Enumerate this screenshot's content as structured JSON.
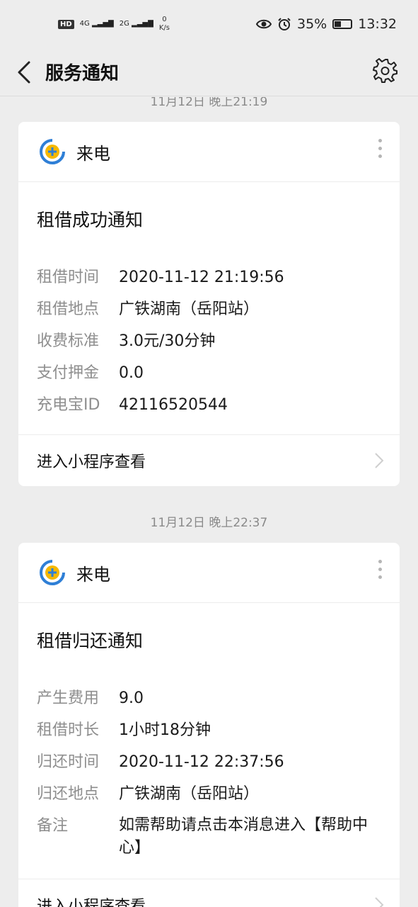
{
  "status_bar": {
    "hd": "HD",
    "net1": "4G",
    "net2": "2G",
    "speed_value": "0",
    "speed_unit": "K/s",
    "battery": "35%",
    "battery_level": 0.35,
    "time": "13:32"
  },
  "header": {
    "title": "服务通知"
  },
  "feed": {
    "partial_timestamp": "11月12日 晚上21:19",
    "cards": [
      {
        "app_name": "来电",
        "title": "租借成功通知",
        "fields": [
          {
            "k": "租借时间",
            "v": "2020-11-12 21:19:56"
          },
          {
            "k": "租借地点",
            "v": "广铁湖南（岳阳站）"
          },
          {
            "k": "收费标准",
            "v": "3.0元/30分钟"
          },
          {
            "k": "支付押金",
            "v": "0.0"
          },
          {
            "k": "充电宝ID",
            "v": "42116520544"
          }
        ],
        "footer": "进入小程序查看"
      },
      {
        "timestamp": "11月12日 晚上22:37",
        "app_name": "来电",
        "title": "租借归还通知",
        "fields": [
          {
            "k": "产生费用",
            "v": "9.0"
          },
          {
            "k": "租借时长",
            "v": "1小时18分钟"
          },
          {
            "k": "归还时间",
            "v": "2020-11-12 22:37:56"
          },
          {
            "k": "归还地点",
            "v": "广铁湖南（岳阳站）"
          },
          {
            "k": "备注",
            "v": "如需帮助请点击本消息进入【帮助中心】"
          }
        ],
        "footer": "进入小程序查看"
      }
    ]
  },
  "colors": {
    "background": "#ededed",
    "card": "#ffffff",
    "label": "#8e8e8e",
    "logo_blue": "#2f7fd6",
    "logo_yellow": "#f5b800"
  }
}
